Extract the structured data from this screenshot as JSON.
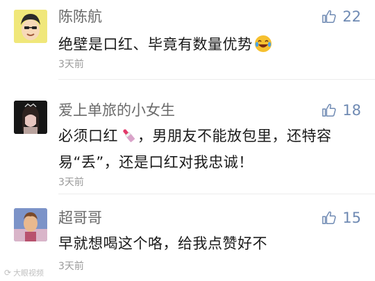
{
  "comments": [
    {
      "username": "陈陈航",
      "likes": "22",
      "text": "绝壁是口红、毕竟有数量优势",
      "emoji": "crying-laughing-emoji",
      "time": "3天前"
    },
    {
      "username": "爱上单旅的小女生",
      "likes": "18",
      "text_part1": "必须口红",
      "emoji": "lipstick-emoji",
      "text_part2": "，男朋友不能放包里，还特容",
      "text_line2": "易“丢”，还是口红对我忠诚！",
      "time": "3天前"
    },
    {
      "username": "超哥哥",
      "likes": "15",
      "text": "早就想喝这个咯，给我点赞好不",
      "time": "3天前"
    }
  ],
  "watermark": "大眼视频",
  "colors": {
    "like": "#6f8ab3",
    "name": "#6a6a6a",
    "time": "#9a9a9a"
  }
}
